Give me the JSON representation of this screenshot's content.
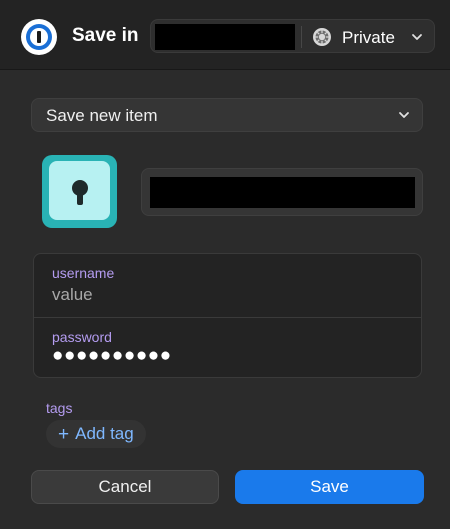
{
  "header": {
    "title": "Save in",
    "vault": {
      "name": "Private",
      "icon": "vault-icon"
    }
  },
  "item_type": {
    "selected": "Save new item"
  },
  "item": {
    "icon": "keyhole-icon"
  },
  "fields": {
    "username": {
      "label": "username",
      "value": "value"
    },
    "password": {
      "label": "password",
      "value": "●●●●●●●●●●"
    }
  },
  "tags": {
    "label": "tags",
    "add_plus": "+",
    "add_label": "Add tag"
  },
  "footer": {
    "cancel_label": "Cancel",
    "save_label": "Save"
  },
  "colors": {
    "background": "#2b2b2b",
    "header": "#232323",
    "accent_blue": "#1a7aeb",
    "label_purple": "#b49cf0",
    "link_blue": "#7fb8ff",
    "item_icon_teal": "#29b3b5"
  }
}
